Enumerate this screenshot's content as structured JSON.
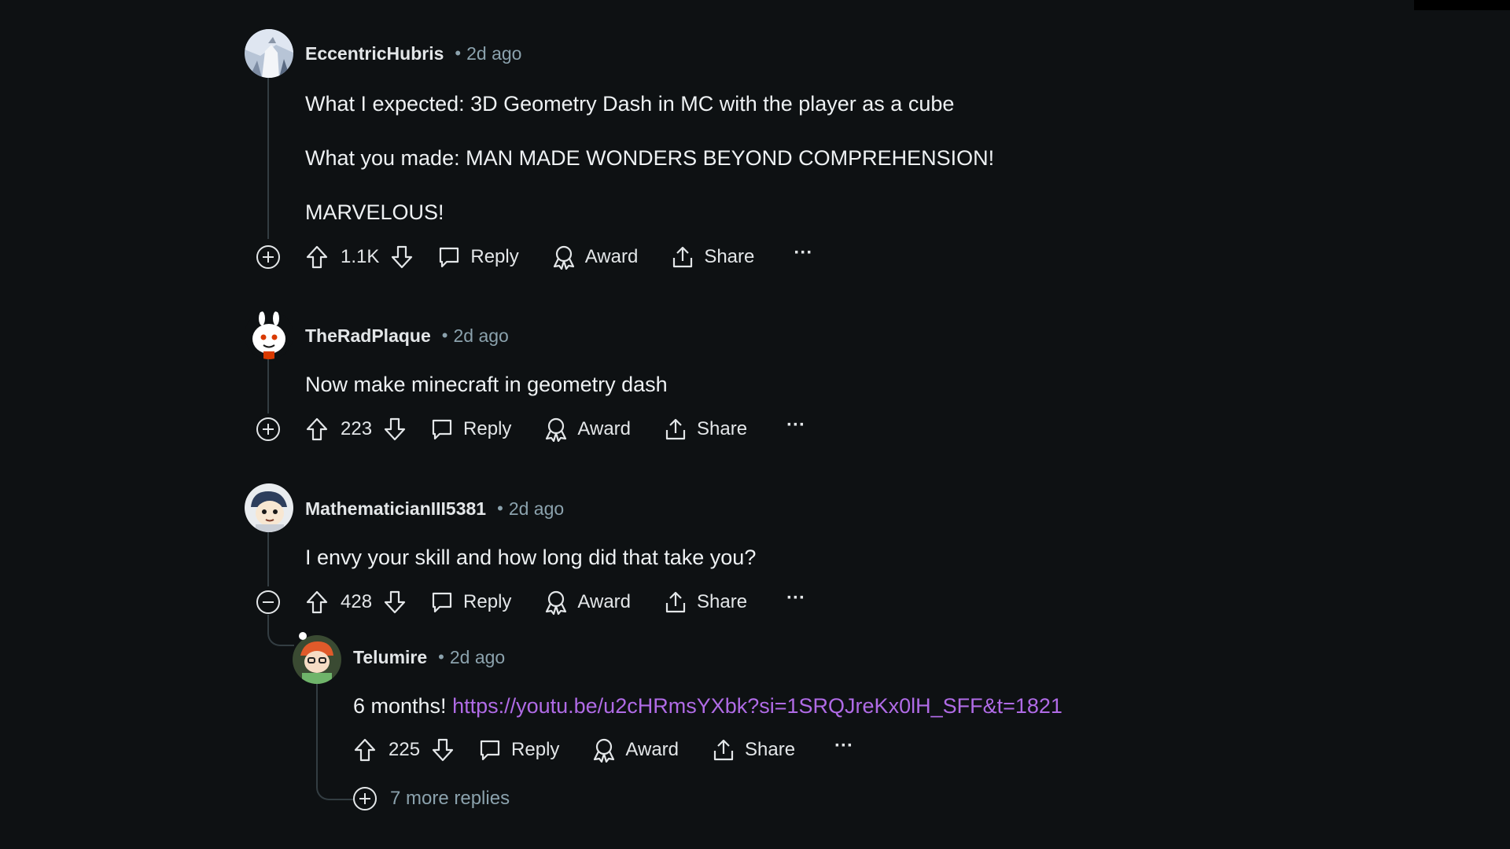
{
  "comments": [
    {
      "username": "EccentricHubris",
      "separator": "•",
      "time": "2d ago",
      "paragraphs": [
        "What I expected: 3D Geometry Dash in MC with the player as a cube",
        "What you made: MAN MADE WONDERS BEYOND COMPREHENSION!",
        "MARVELOUS!"
      ],
      "votes": "1.1K",
      "reply_label": "Reply",
      "award_label": "Award",
      "share_label": "Share",
      "more_label": "···"
    },
    {
      "username": "TheRadPlaque",
      "separator": "•",
      "time": "2d ago",
      "paragraphs": [
        "Now make minecraft in geometry dash"
      ],
      "votes": "223",
      "reply_label": "Reply",
      "award_label": "Award",
      "share_label": "Share",
      "more_label": "···"
    },
    {
      "username": "MathematicianIII5381",
      "separator": "•",
      "time": "2d ago",
      "paragraphs": [
        "I envy your skill and how long did that take you?"
      ],
      "votes": "428",
      "reply_label": "Reply",
      "award_label": "Award",
      "share_label": "Share",
      "more_label": "···",
      "reply": {
        "username": "Telumire",
        "separator": "•",
        "time": "2d ago",
        "text_prefix": "6 months! ",
        "link": "https://youtu.be/u2cHRmsYXbk?si=1SRQJreKx0lH_SFF&t=1821",
        "votes": "225",
        "reply_label": "Reply",
        "award_label": "Award",
        "share_label": "Share",
        "more_label": "···"
      }
    }
  ],
  "more_replies_label": "7 more replies",
  "colors": {
    "background": "#0e1113",
    "text": "#e3e6e8",
    "meta": "#8ba2ad",
    "thread_line": "#333d42",
    "link": "#b06be6"
  },
  "icons": {
    "expand": "plus-circle-icon",
    "collapse": "minus-circle-icon",
    "upvote": "upvote-arrow-icon",
    "downvote": "downvote-arrow-icon",
    "reply": "comment-bubble-icon",
    "award": "award-ribbon-icon",
    "share": "share-upload-icon",
    "more": "ellipsis-icon"
  }
}
